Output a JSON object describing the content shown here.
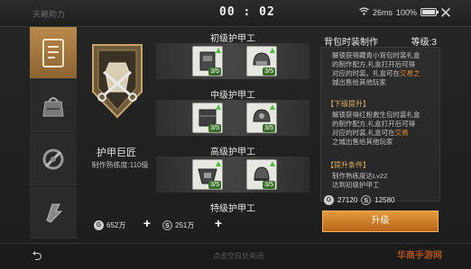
{
  "header": {
    "app_title": "天籁助力",
    "clock": "00 : 02",
    "network": "26ms",
    "battery": "100%",
    "battery_level": 1.0
  },
  "tabs": [
    {
      "icon": "armor-craft-icon",
      "active": true
    },
    {
      "icon": "bag-craft-icon",
      "active": false
    },
    {
      "icon": "tool-craft-icon",
      "active": false
    },
    {
      "icon": "gear-craft-icon",
      "active": false
    }
  ],
  "profession": {
    "name": "护甲巨匠",
    "level_text": "制作熟练度:110级"
  },
  "tiers": [
    {
      "label": "初级护甲工",
      "slots": [
        {
          "count": "3/5"
        },
        {
          "count": "3/5"
        }
      ]
    },
    {
      "label": "中级护甲工",
      "slots": [
        {
          "count": "3/5"
        },
        {
          "count": "3/5"
        }
      ]
    },
    {
      "label": "高级护甲工",
      "slots": [
        {
          "count": "3/5"
        },
        {
          "count": "3/5"
        }
      ]
    },
    {
      "label": "特级护甲工",
      "slots": []
    }
  ],
  "currency": [
    {
      "symbol": "G",
      "value": "652万"
    },
    {
      "symbol": "S",
      "value": "251万"
    }
  ],
  "detail": {
    "title": "背包时装制作",
    "level": "等级:3",
    "desc_lines": [
      "解锁获得藏青小背包时装礼盒",
      "的制作配方,礼盒打开后可得",
      "对应的时装。礼盒可在",
      "交易之",
      "城出售给其他玩家"
    ],
    "section_next": "【下级提升】",
    "next_lines": [
      "解锁获得红粉救生包时装礼盒",
      "的制作配方,礼盒打开后可得",
      "对应的时装,礼盒可在",
      "交易",
      "之城出售给其他玩家"
    ],
    "section_req": "【提升条件】",
    "req_lines": [
      "制作熟练度达Lv22",
      "达到初级护甲工"
    ],
    "cost_gold_symbol": "G",
    "cost_gold": "27120",
    "cost_silver_symbol": "S",
    "cost_silver": "12580",
    "upgrade_label": "升级"
  },
  "footer": {
    "back_icon": "back-arrow-icon",
    "hint": "点击空白处关闭",
    "watermark": "华商手游网"
  },
  "colors": {
    "accent": "#e59a3b",
    "tab_active": "#b98a4c",
    "highlight": "#e08a2e",
    "count_badge": "#3d6f2c"
  }
}
